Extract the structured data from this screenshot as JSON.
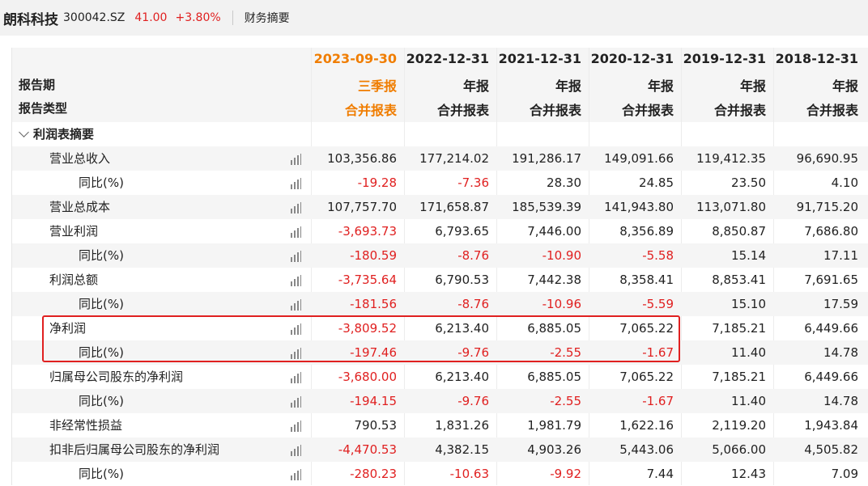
{
  "header": {
    "company": "朗科科技",
    "code": "300042.SZ",
    "price": "41.00",
    "change": "+3.80%",
    "tab": "财务摘要"
  },
  "table": {
    "period_label": "报告期",
    "type_label": "报告类型",
    "dates": [
      "2023-09-30",
      "2022-12-31",
      "2021-12-31",
      "2020-12-31",
      "2019-12-31",
      "2018-12-31"
    ],
    "period_types": [
      "三季报",
      "年报",
      "年报",
      "年报",
      "年报",
      "年报"
    ],
    "report_types": [
      "合并报表",
      "合并报表",
      "合并报表",
      "合并报表",
      "合并报表",
      "合并报表"
    ],
    "section": "利润表摘要",
    "rows": [
      {
        "label": "营业总收入",
        "values": [
          "103,356.86",
          "177,214.02",
          "191,286.17",
          "149,091.66",
          "119,412.35",
          "96,690.95"
        ]
      },
      {
        "label": "同比(%)",
        "values": [
          "-19.28",
          "-7.36",
          "28.30",
          "24.85",
          "23.50",
          "4.10"
        ]
      },
      {
        "label": "营业总成本",
        "values": [
          "107,757.70",
          "171,658.87",
          "185,539.39",
          "141,943.80",
          "113,071.80",
          "91,715.20"
        ]
      },
      {
        "label": "营业利润",
        "values": [
          "-3,693.73",
          "6,793.65",
          "7,446.00",
          "8,356.89",
          "8,850.87",
          "7,686.80"
        ]
      },
      {
        "label": "同比(%)",
        "values": [
          "-180.59",
          "-8.76",
          "-10.90",
          "-5.58",
          "15.14",
          "17.11"
        ]
      },
      {
        "label": "利润总额",
        "values": [
          "-3,735.64",
          "6,790.53",
          "7,442.38",
          "8,358.41",
          "8,853.41",
          "7,691.65"
        ]
      },
      {
        "label": "同比(%)",
        "values": [
          "-181.56",
          "-8.76",
          "-10.96",
          "-5.59",
          "15.10",
          "17.59"
        ]
      },
      {
        "label": "净利润",
        "values": [
          "-3,809.52",
          "6,213.40",
          "6,885.05",
          "7,065.22",
          "7,185.21",
          "6,449.66"
        ]
      },
      {
        "label": "同比(%)",
        "values": [
          "-197.46",
          "-9.76",
          "-2.55",
          "-1.67",
          "11.40",
          "14.78"
        ]
      },
      {
        "label": "归属母公司股东的净利润",
        "values": [
          "-3,680.00",
          "6,213.40",
          "6,885.05",
          "7,065.22",
          "7,185.21",
          "6,449.66"
        ]
      },
      {
        "label": "同比(%)",
        "values": [
          "-194.15",
          "-9.76",
          "-2.55",
          "-1.67",
          "11.40",
          "14.78"
        ]
      },
      {
        "label": "非经常性损益",
        "values": [
          "790.53",
          "1,831.26",
          "1,981.79",
          "1,622.16",
          "2,119.20",
          "1,943.84"
        ]
      },
      {
        "label": "扣非后归属母公司股东的净利润",
        "values": [
          "-4,470.53",
          "4,382.15",
          "4,903.26",
          "5,443.06",
          "5,066.00",
          "4,505.82"
        ]
      },
      {
        "label": "同比(%)",
        "values": [
          "-280.23",
          "-10.63",
          "-9.92",
          "7.44",
          "12.43",
          "7.09"
        ]
      }
    ]
  },
  "colors": {
    "negative": "#e02020",
    "current_period": "#f07d00",
    "highlight_box": "#e02020"
  },
  "icons": {
    "row_chart": "bar-chart-icon",
    "section_toggle": "chevron-down-icon"
  }
}
